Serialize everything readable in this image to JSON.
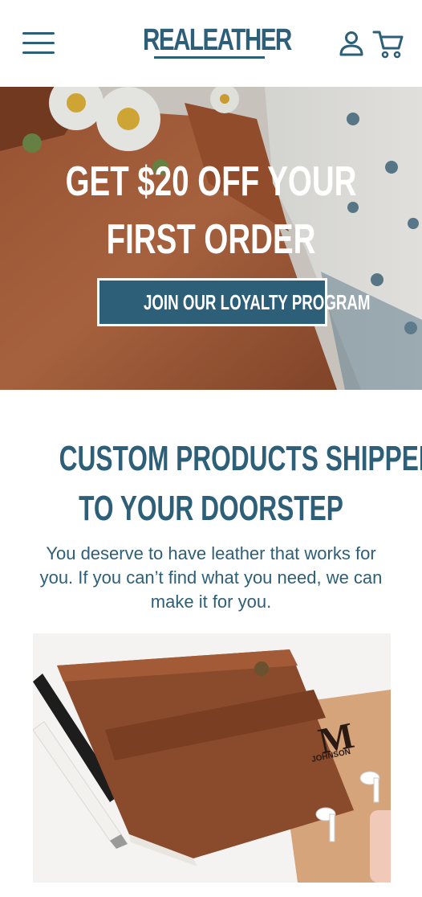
{
  "header": {
    "logo_text": "REALEATHER",
    "menu_icon": "hamburger-menu-icon",
    "account_icon": "user-icon",
    "cart_icon": "cart-icon"
  },
  "hero": {
    "title_line1": "GET $20 OFF YOUR",
    "title_line2": "FIRST ORDER",
    "button_label": "JOIN OUR LOYALTY PROGRAM"
  },
  "section": {
    "title_line1": "CUSTOM PRODUCTS SHIPPED",
    "title_line2": "TO YOUR DOORSTEP",
    "text": "You deserve to have leather that works for you. If you can’t find what you need, we can make it for you.",
    "engraving_letter": "M",
    "engraving_name": "JOHNSON"
  },
  "colors": {
    "brand": "#2d5f78",
    "leather": "#8a4a2c",
    "background": "#ffffff"
  }
}
